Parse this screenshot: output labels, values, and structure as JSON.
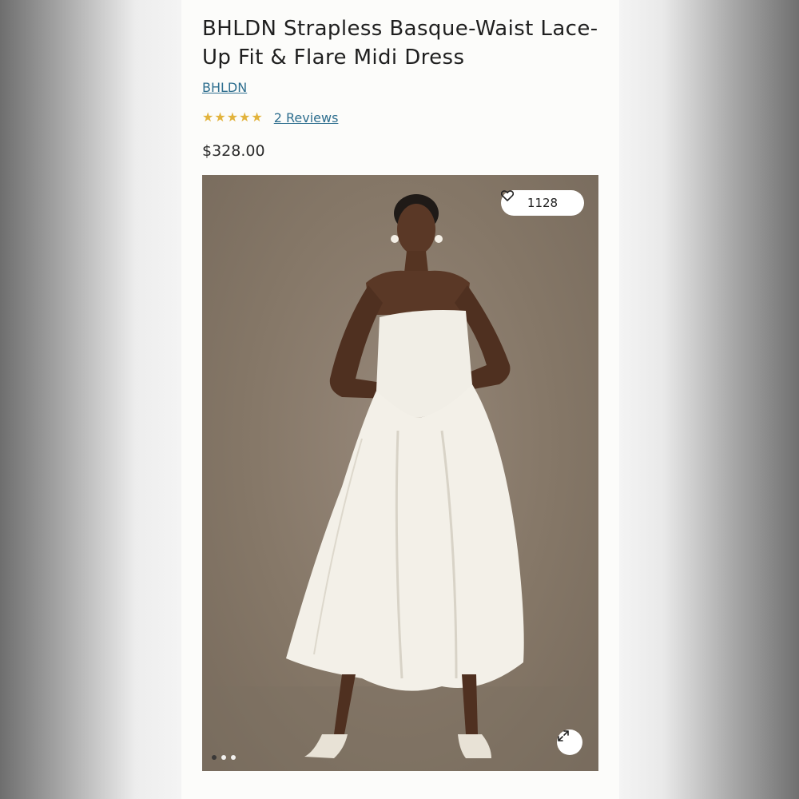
{
  "product": {
    "title": "BHLDN Strapless Basque-Waist Lace-Up Fit & Flare Midi Dress",
    "brand": "BHLDN",
    "rating_stars": 5,
    "reviews_label": "2 Reviews",
    "price": "$328.00"
  },
  "gallery": {
    "favorites_count": "1128",
    "favorite_icon": "heart-outline-icon",
    "expand_icon": "expand-arrows-icon",
    "slide_count": 3,
    "active_slide": 1
  },
  "colors": {
    "link": "#2f6f8f",
    "star": "#e2b33c",
    "photo_backdrop": "#857767"
  }
}
